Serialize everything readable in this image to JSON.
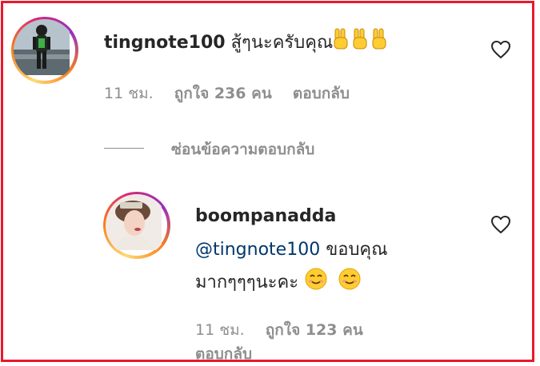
{
  "comment": {
    "username": "tingnote100",
    "text": "สู้ๆนะครับคุณ",
    "emojis": [
      "victory-hand",
      "victory-hand",
      "victory-hand"
    ],
    "time": "11 ชม.",
    "likes": "ถูกใจ 236 คน",
    "reply_label": "ตอบกลับ",
    "hide_replies_label": "ซ่อนข้อความตอบกลับ"
  },
  "reply": {
    "username": "boompanadda",
    "mention": "@tingnote100",
    "text_line1": " ขอบคุณ",
    "text_line2": "มากๆๆๆนะคะ",
    "emojis": [
      "smiling-face",
      "smiling-face"
    ],
    "time": "11 ชม.",
    "likes": "ถูกใจ 123 คน",
    "reply_label": "ตอบกลับ"
  },
  "colors": {
    "frame": "#e8192c",
    "text": "#262626",
    "muted": "#8e8e8e",
    "mention": "#00376b"
  }
}
